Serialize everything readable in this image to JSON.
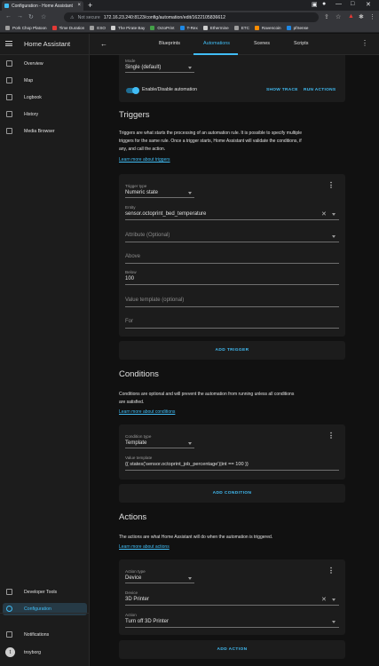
{
  "browser": {
    "tab_title": "Configuration - Home Assistant",
    "tab_close": "×",
    "new_tab": "+",
    "not_secure": "Not secure",
    "url": "172.16.23.240:8123/config/automation/edit/1622105836612",
    "bookmarks": [
      {
        "label": "Pork Chop Platoon",
        "color": "#9e9e9e"
      },
      {
        "label": "Time Duration",
        "color": "#e53935"
      },
      {
        "label": "ESO",
        "color": "#9e9e9e"
      },
      {
        "label": "The Pirate Bay",
        "color": "#cfcfcf"
      },
      {
        "label": "OctoPrint",
        "color": "#43a047"
      },
      {
        "label": "T-Rex",
        "color": "#1e88e5"
      },
      {
        "label": "Ethermine",
        "color": "#cfcfcf"
      },
      {
        "label": "ETC",
        "color": "#9e9e9e"
      },
      {
        "label": "Ravencoin",
        "color": "#fb8c00"
      },
      {
        "label": "pfSense",
        "color": "#1e88e5"
      }
    ]
  },
  "sidebar": {
    "title": "Home Assistant",
    "items": [
      {
        "label": "Overview",
        "icon": "overview-icon"
      },
      {
        "label": "Map",
        "icon": "map-icon"
      },
      {
        "label": "Logbook",
        "icon": "logbook-icon"
      },
      {
        "label": "History",
        "icon": "history-icon"
      },
      {
        "label": "Media Browser",
        "icon": "media-browser-icon"
      }
    ],
    "bottom_items": [
      {
        "label": "Developer Tools",
        "icon": "developer-tools-icon"
      },
      {
        "label": "Configuration",
        "icon": "configuration-icon"
      },
      {
        "label": "Notifications",
        "icon": "notifications-icon"
      }
    ],
    "user": {
      "initial": "t",
      "name": "troyborg"
    }
  },
  "header": {
    "tabs": [
      "Blueprints",
      "Automations",
      "Scenes",
      "Scripts"
    ],
    "active_tab": "Automations"
  },
  "mode": {
    "label": "Mode",
    "value": "Single (default)"
  },
  "enable": {
    "label": "Enable/Disable automation",
    "show_trace": "SHOW TRACE",
    "run_actions": "RUN ACTIONS"
  },
  "triggers": {
    "title": "Triggers",
    "description": "Triggers are what starts the processing of an automation rule. It is possible to specify multiple triggers for the same rule. Once a trigger starts, Home Assistant will validate the conditions, if any, and call the action.",
    "learn_more": "Learn more about triggers",
    "trigger_type_label": "Trigger type",
    "trigger_type": "Numeric state",
    "entity_label": "Entity",
    "entity": "sensor.octoprint_bed_temperature",
    "attribute_placeholder": "Attribute (Optional)",
    "above_placeholder": "Above",
    "below_label": "Below",
    "below": "100",
    "value_template_placeholder": "Value template (optional)",
    "for_placeholder": "For",
    "add_button": "ADD TRIGGER"
  },
  "conditions": {
    "title": "Conditions",
    "description": "Conditions are optional and will prevent the automation from running unless all conditions are satisfied.",
    "learn_more": "Learn more about conditions",
    "condition_type_label": "Condition type",
    "condition_type": "Template",
    "value_template_label": "Value template",
    "value_template": "{{ states('sensor.octoprint_job_percentage')|int == 100 }}",
    "add_button": "ADD CONDITION"
  },
  "actions": {
    "title": "Actions",
    "description": "The actions are what Home Assistant will do when the automation is triggered.",
    "learn_more": "Learn more about actions",
    "action_type_label": "Action type",
    "action_type": "Device",
    "device_label": "Device",
    "device": "3D Printer",
    "action_label": "Action",
    "action": "Turn off 3D Printer",
    "add_button": "ADD ACTION"
  },
  "colors": {
    "accent": "#41bdf5",
    "background": "#111111",
    "card": "#1c1c1c"
  }
}
